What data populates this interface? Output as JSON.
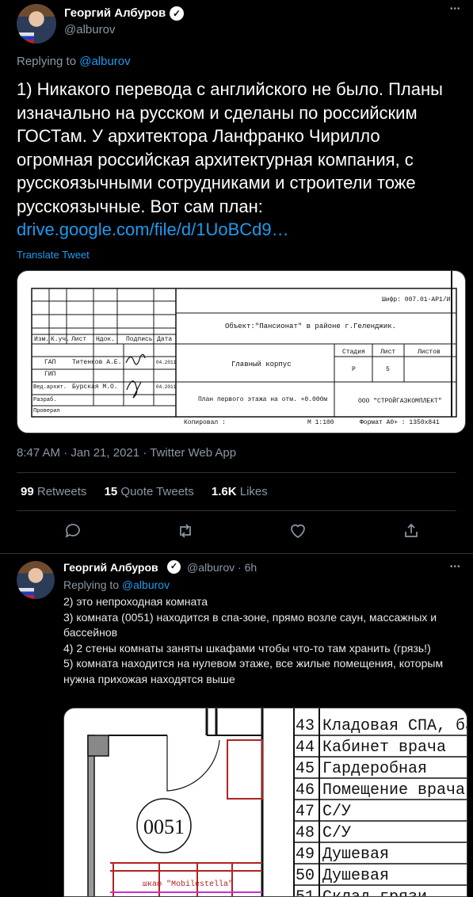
{
  "tweet1": {
    "author_name": "Георгий Албуров",
    "author_handle": "@alburov",
    "more_glyph": "•••",
    "replying_prefix": "Replying to ",
    "replying_handle": "@alburov",
    "text": "1) Никакого перевода с английского не было. Планы изначально на русском и сделаны по российским ГОСТам. У архитектора Ланфранко Чирилло огромная российская архитектурная компания, с русскоязычными сотрудниками и строители тоже русскоязычные. Вот сам план:",
    "link_text": "drive.google.com/file/d/1UoBCd9…",
    "translate_label": "Translate Tweet",
    "timestamp": "8:47 AM · Jan 21, 2021 · Twitter Web App",
    "stats": {
      "retweets_count": "99",
      "retweets_label": "Retweets",
      "quote_count": "15",
      "quote_label": "Quote Tweets",
      "likes_count": "1.6K",
      "likes_label": "Likes"
    },
    "plan_image": {
      "cipher": "Шифр: 007.01-АР1/И",
      "object": "Объект:\"Пансионат\" в районе г.Геленджик.",
      "headers": [
        "Изм.",
        "К.уч.",
        "Лист",
        "Ндок.",
        "Подпись",
        "Дата"
      ],
      "rows": [
        {
          "role": "ГАП",
          "name": "Титенков А.Е.",
          "date": "04.2011"
        },
        {
          "role": "ГИП",
          "name": "",
          "date": ""
        },
        {
          "role": "Вед.архит.",
          "name": "Бурская М.О.",
          "date": "04.2011"
        },
        {
          "role": "Разраб.",
          "name": "",
          "date": ""
        },
        {
          "role": "Проверил",
          "name": "",
          "date": ""
        }
      ],
      "building": "Главный корпус",
      "stage_header": "Стадия",
      "sheet_header": "Лист",
      "sheets_header": "Листов",
      "stage": "Р",
      "sheet": "5",
      "drawing_title": "План первого этажа на отм. +0.000м",
      "company": "ООО \"СТРОЙГАЗКОМПЛЕКТ\"",
      "copied": "Копировал :",
      "scale": "М 1:100",
      "format": "Формат А0+ : 1350х841"
    }
  },
  "tweet2": {
    "author_name": "Георгий Албуров",
    "author_handle": "@alburov",
    "time": "· 6h",
    "more_glyph": "•••",
    "replying_prefix": "Replying to ",
    "replying_handle": "@alburov",
    "lines": [
      "2) это непроходная комната",
      "3) комната (0051) находится в спа-зоне, прямо возле саун, массажных и бассейнов",
      "4) 2 стены комнаты заняты шкафами чтобы что-то там хранить (грязь!)",
      "5) комната находится на нулевом этаже, все жилые помещения, которым нужна прихожая находятся выше"
    ],
    "plan": {
      "room_label": "0051",
      "cabinet_label": "шкаф \"Mobilestella\"",
      "table": [
        {
          "num": "43",
          "name": "Кладовая СПА, басс"
        },
        {
          "num": "44",
          "name": "Кабинет врача"
        },
        {
          "num": "45",
          "name": "Гардеробная"
        },
        {
          "num": "46",
          "name": "Помещение врача и"
        },
        {
          "num": "47",
          "name": "С/У"
        },
        {
          "num": "48",
          "name": "С/У"
        },
        {
          "num": "49",
          "name": "Душевая"
        },
        {
          "num": "50",
          "name": "Душевая"
        },
        {
          "num": "51",
          "name": "Склад грязи"
        }
      ]
    }
  },
  "colors": {
    "background": "#000000",
    "accent": "#1d9bf0",
    "muted": "#8b98a5",
    "divider": "#2f3336"
  }
}
